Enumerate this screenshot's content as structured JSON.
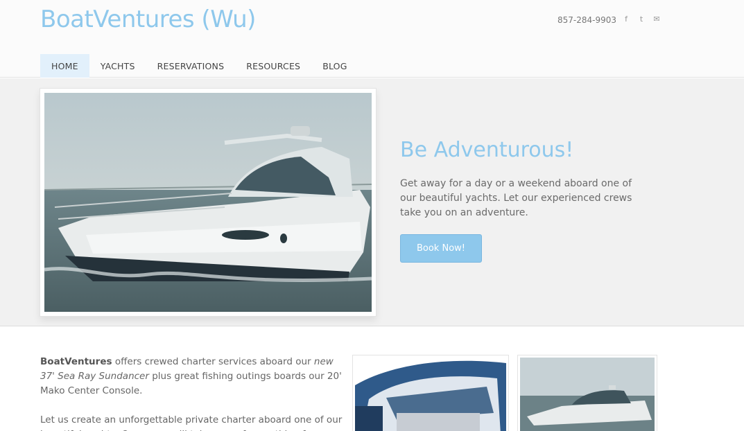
{
  "header": {
    "site_title": "BoatVentures (Wu)",
    "phone": "857-284-9903",
    "social": [
      {
        "icon": "facebook-icon",
        "glyph": "f"
      },
      {
        "icon": "twitter-icon",
        "glyph": "t"
      },
      {
        "icon": "email-icon",
        "glyph": "✉"
      }
    ]
  },
  "nav": {
    "items": [
      {
        "label": "HOME",
        "active": true
      },
      {
        "label": "YACHTS"
      },
      {
        "label": "RESERVATIONS"
      },
      {
        "label": "RESOURCES"
      },
      {
        "label": "BLOG"
      }
    ]
  },
  "hero": {
    "title": "Be Adventurous!",
    "text": "Get away for a day or a weekend aboard one of our beautiful yachts. Let our experienced crews take you on an adventure.",
    "button": "Book Now!"
  },
  "intro": {
    "brand": "BoatVentures",
    "p1_a": " offers crewed charter services aboard our ",
    "p1_em": "new 37' Sea Ray Sundancer",
    "p1_b": " plus great fishing outings boards our 20' Mako Center Console.",
    "p2": "Let us create an unforgettable private charter aboard one of our beautiful yachts. Our crews will take care of everything for you."
  },
  "colors": {
    "accent": "#8ec8ec",
    "nav_active": "#e2f0fb"
  }
}
